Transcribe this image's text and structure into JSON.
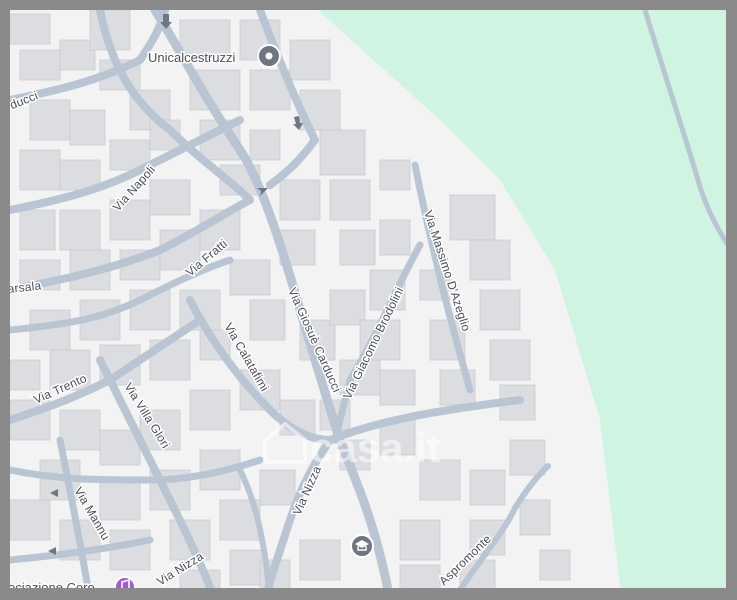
{
  "colors": {
    "background": "#f3f3f4",
    "park": "#cff4e1",
    "road": "#b9c5d3",
    "building": "#dcdde0",
    "building_stroke": "#c9cbcf",
    "pin": "#6f7682",
    "frame": "#8a8a8a"
  },
  "streets": {
    "via_napoli": "Via Napoli",
    "via_fratti": "Via Fratti",
    "via_giosue_carducci": "Via Giosuè Carducci",
    "via_giacomo_brodolini": "Via Giacomo Brodolini",
    "via_massimo_dazeglio": "Via Massimo D'Azeglio",
    "via_calatafimi": "Via Calatafimi",
    "via_trento": "Via Trento",
    "via_villa_glori": "Via Villa Glori",
    "via_nizza": "Via Nizza",
    "via_nizza_2": "Via Nizza",
    "via_mannu": "Via Mannu",
    "aspromonte": "Aspromonte",
    "marsala_partial": "arsala",
    "carducci_partial": "rducci"
  },
  "pois": {
    "unicalcestruzzi": {
      "label": "Unicalcestruzzi",
      "icon": "map-pin-icon"
    },
    "associazione": {
      "label": "ociazione Coro",
      "icon": "music-note-icon"
    },
    "school": {
      "icon": "graduation-cap-icon"
    }
  },
  "watermark": {
    "text": "casa.it",
    "icon": "house-icon"
  }
}
